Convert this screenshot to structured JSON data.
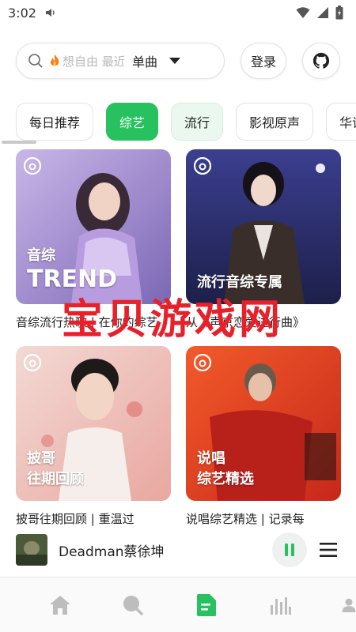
{
  "status_bar": {
    "time": "3:02"
  },
  "search": {
    "placeholder": "想自由 最近",
    "type_label": "单曲"
  },
  "header": {
    "login_label": "登录"
  },
  "categories": [
    {
      "label": "每日推荐"
    },
    {
      "label": "综艺"
    },
    {
      "label": "流行"
    },
    {
      "label": "影视原声"
    },
    {
      "label": "华语"
    }
  ],
  "cards": [
    {
      "overlay_lines": [
        "音综",
        "TREND"
      ],
      "title": "音综流行热歌 | 在你的综艺"
    },
    {
      "overlay_lines": [
        "流行音综专属"
      ],
      "title": "从《声京恋爱进行曲》"
    },
    {
      "overlay_lines": [
        "披哥",
        "往期回顾"
      ],
      "title": "披哥往期回顾 | 重温过"
    },
    {
      "overlay_lines": [
        "说唱",
        "综艺精选"
      ],
      "title": "说唱综艺精选 | 记录每"
    }
  ],
  "watermark": "宝贝游戏网",
  "now_playing": {
    "title": "Deadman蔡徐坤"
  },
  "bottom_nav": [
    {
      "icon": "home-icon"
    },
    {
      "icon": "search-icon"
    },
    {
      "icon": "document-icon",
      "active": true
    },
    {
      "icon": "chart-icon"
    },
    {
      "icon": "user-icon"
    }
  ],
  "colors": {
    "accent": "#27c25f",
    "watermark": "#e8202a"
  }
}
